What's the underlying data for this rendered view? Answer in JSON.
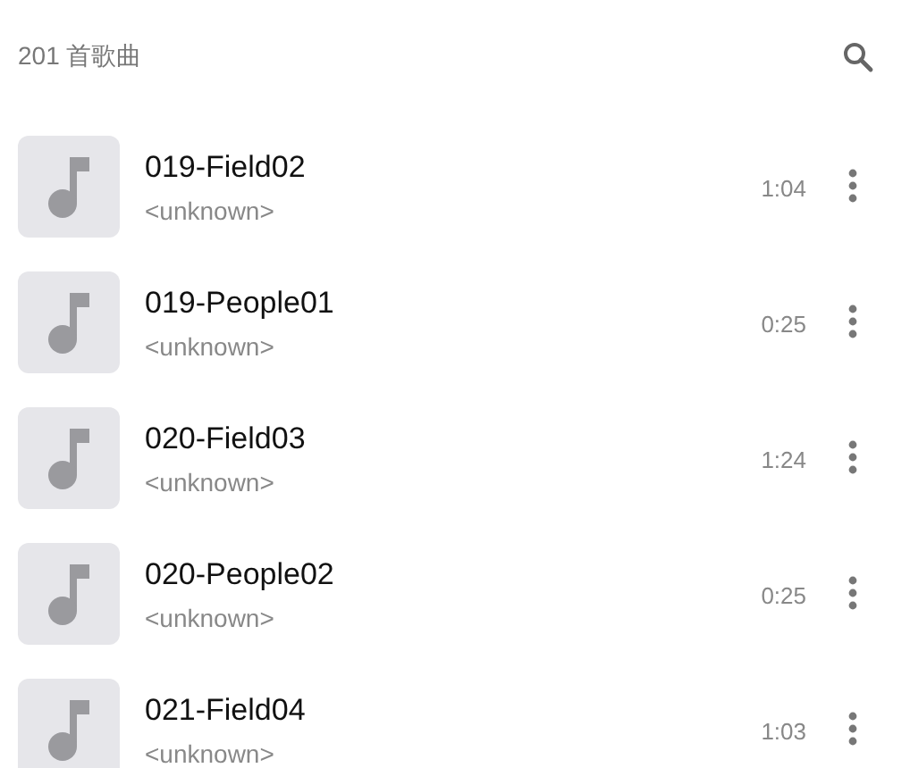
{
  "header": {
    "title": "201 首歌曲"
  },
  "songs": [
    {
      "title": "019-Field02",
      "artist": "<unknown>",
      "duration": "1:04"
    },
    {
      "title": "019-People01",
      "artist": "<unknown>",
      "duration": "0:25"
    },
    {
      "title": "020-Field03",
      "artist": "<unknown>",
      "duration": "1:24"
    },
    {
      "title": "020-People02",
      "artist": "<unknown>",
      "duration": "0:25"
    },
    {
      "title": "021-Field04",
      "artist": "<unknown>",
      "duration": "1:03"
    }
  ]
}
